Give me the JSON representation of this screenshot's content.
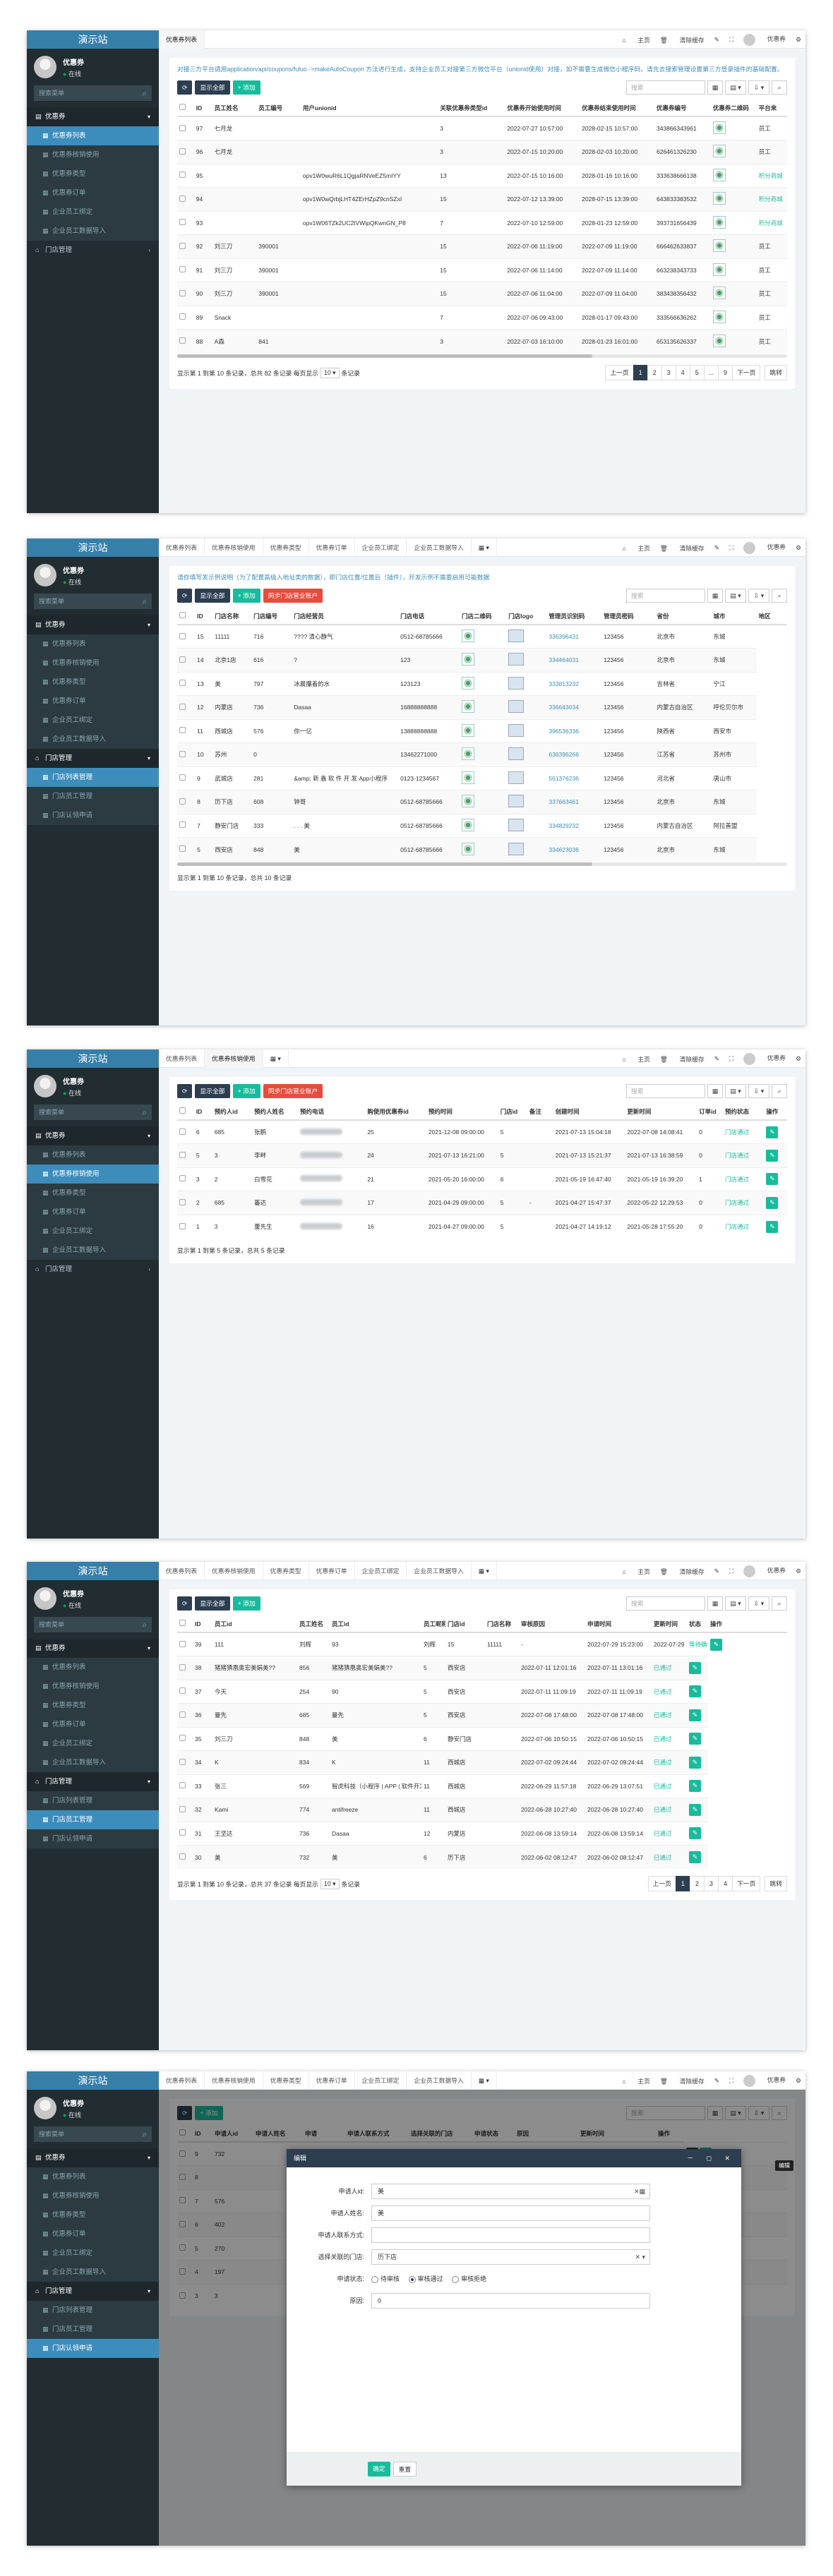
{
  "app": {
    "logo": "演示站",
    "user": "优惠券",
    "status": "在线",
    "search_placeholder": "搜索菜单"
  },
  "menu": {
    "group": "优惠券",
    "items": [
      "优惠券列表",
      "优惠券核销使用",
      "优惠券类型",
      "优惠券订单",
      "企业员工绑定",
      "企业员工数据导入"
    ],
    "store_group": "门店管理",
    "store_items": [
      "门店列表管理",
      "门店员工管理",
      "门店认领申请"
    ]
  },
  "topbar": {
    "home": "主页",
    "clear": "清除缓存",
    "admin": "优惠券"
  },
  "common": {
    "refresh": "⟳",
    "show_all": "显示全部",
    "add": "添加",
    "search_placeholder": "搜索",
    "edit": "编辑"
  },
  "shot1": {
    "tab": "优惠券列表",
    "tip": "对接三方平台调用application/api/coupons/fuluo ->makeAutoCoupon 方法进行生成，支持企业员工对接第三方微信平台（unionid使用）对接，如不需要生成微信小程序码，请先去搜索管理设置第三方登录插件的基础配置。",
    "headers": [
      "",
      "ID",
      "员工姓名",
      "员工编号",
      "用户unionid",
      "关联优惠券类型id",
      "优惠券开始使用时间",
      "优惠券结束使用时间",
      "优惠券编号",
      "优惠券二维码",
      "平台来"
    ],
    "rows": [
      [
        "97",
        "七月龙",
        "",
        "",
        "3",
        "2022-07-27 10:57:00",
        "2028-02-15 10:57:00",
        "343866343961",
        "",
        "员工"
      ],
      [
        "96",
        "七月龙",
        "",
        "",
        "3",
        "2022-07-15 10:20:00",
        "2028-02-03 10:20:00",
        "626461326230",
        "",
        "员工"
      ],
      [
        "95",
        "",
        "",
        "opv1W0wuR6L1QgjaRNVeEZ5mIYY",
        "13",
        "2022-07-15 10:16:00",
        "2028-01-16 10:16:00",
        "333638666138",
        "",
        "积分商城"
      ],
      [
        "94",
        "",
        "",
        "opv1W0wQrbjLHT4ZErHZpZ9cnSZxI",
        "15",
        "2022-07-12 13:39:00",
        "2028-07-15 13:39:00",
        "643833383532",
        "",
        "积分商城"
      ],
      [
        "93",
        "",
        "",
        "opv1W06TZk2UC2tVWipQKwnGN_P8",
        "7",
        "2022-07-10 12:59:00",
        "2028-01-23 12:59:00",
        "393731656439",
        "",
        "积分商城"
      ],
      [
        "92",
        "刘三刀",
        "390001",
        "",
        "15",
        "2022-07-06 11:19:00",
        "2022-07-09 11:19:00",
        "666462633837",
        "",
        "员工"
      ],
      [
        "91",
        "刘三刀",
        "390001",
        "",
        "15",
        "2022-07-06 11:14:00",
        "2022-07-09 11:14:00",
        "663238343733",
        "",
        "员工"
      ],
      [
        "90",
        "刘三刀",
        "390001",
        "",
        "15",
        "2022-07-06 11:04:00",
        "2022-07-09 11:04:00",
        "383438356432",
        "",
        "员工"
      ],
      [
        "89",
        "Snack",
        "",
        "",
        "7",
        "2022-07-06 09:43:00",
        "2028-01-17 09:43:00",
        "333566636262",
        "",
        "员工"
      ],
      [
        "88",
        "A森",
        "841",
        "",
        "3",
        "2022-07-03 16:10:00",
        "2028-01-23 16:01:00",
        "653135626337",
        "",
        "员工"
      ]
    ],
    "footer": {
      "summary": "显示第 1 到第 10 条记录，总共 82 条记录 每页显示",
      "per": "10 ▾",
      "suffix": "条记录"
    },
    "pages": [
      "上一页",
      "1",
      "2",
      "3",
      "4",
      "5",
      "...",
      "9",
      "下一页",
      "跳转"
    ]
  },
  "shot2": {
    "tabs": [
      "优惠券列表",
      "优惠券核销使用",
      "优惠券类型",
      "优惠券订单",
      "企业员工绑定",
      "企业员工数据导入"
    ],
    "tip": "请你填写发示例说明（为了配置高级入地址类的数据），即门店位置/位置后（插件），开发示例不需要启用可能数据",
    "sync": "同步门店营业账户",
    "headers": [
      "",
      "ID",
      "门店名称",
      "门店编号",
      "门店经营员",
      "门店电话",
      "门店二维码",
      "门店logo",
      "管理员识别码",
      "管理员密码",
      "省份",
      "城市",
      "地区"
    ],
    "rows": [
      [
        "15",
        "11111",
        "716",
        "???? 清心静气",
        "0512-68785666",
        "",
        "",
        "336396431",
        "123456",
        "北京市",
        "东城"
      ],
      [
        "14",
        "北京1店",
        "616",
        "?",
        "123",
        "",
        "",
        "334464031",
        "123456",
        "北京市",
        "东城"
      ],
      [
        "13",
        "美",
        "797",
        "冰晨攥着的水",
        "123123",
        "",
        "",
        "333813232",
        "123456",
        "吉林省",
        "宁江"
      ],
      [
        "12",
        "内蒙店",
        "736",
        "Dasaa",
        "16888888888",
        "",
        "",
        "336643034",
        "123456",
        "内蒙古自治区",
        "呼伦贝尔市"
      ],
      [
        "11",
        "西城店",
        "576",
        "你一亿",
        "13888888888",
        "",
        "",
        "396536336",
        "123456",
        "陕西省",
        "西安市"
      ],
      [
        "10",
        "苏州",
        "0",
        "",
        "13462271000",
        "",
        "",
        "636396266",
        "123456",
        "江苏省",
        "苏州市"
      ],
      [
        "9",
        "武城店",
        "281",
        "&amp; 新 鑫 软 件 开 发 App小程序",
        "0123-1234567",
        "",
        "",
        "561376236",
        "123456",
        "河北省",
        "唐山市"
      ],
      [
        "8",
        "历下店",
        "608",
        "钟哥",
        "0512-68785666",
        "",
        "",
        "337663461",
        "123456",
        "北京市",
        "东城"
      ],
      [
        "7",
        "静安门店",
        "333",
        ". . . 美",
        "0512-68785666",
        "",
        "",
        "334829232",
        "123456",
        "内蒙古自治区",
        "阿拉善盟"
      ],
      [
        "5",
        "西安店",
        "848",
        "美",
        "0512-68785666",
        "",
        "",
        "334623036",
        "123456",
        "北京市",
        "东城"
      ]
    ],
    "footer": "显示第 1 到第 10 条记录，总共 10 条记录"
  },
  "shot3": {
    "tabs": [
      "优惠券列表",
      "优惠券核销使用"
    ],
    "sync": "同步门店营业账户",
    "headers": [
      "",
      "ID",
      "预约人id",
      "预约人姓名",
      "预约电话",
      "购使用优惠券id",
      "预约时间",
      "门店id",
      "备注",
      "创建时间",
      "更新时间",
      "订单id",
      "预约状态",
      "操作"
    ],
    "rows": [
      [
        "6",
        "685",
        "张鹏",
        "",
        "25",
        "2021-12-08 09:00:00",
        "5",
        "",
        "2021-07-13 15:04:18",
        "2022-07-08 14:08:41",
        "0",
        "门店通过"
      ],
      [
        "5",
        "3",
        "李畔",
        "",
        "24",
        "2021-07-13 16:21:00",
        "5",
        "",
        "2021-07-13 15:21:37",
        "2021-07-13 16:38:59",
        "0",
        "门店通过"
      ],
      [
        "3",
        "2",
        "白雪花",
        "",
        "21",
        "2021-05-20 16:00:00",
        "6",
        "",
        "2021-05-19 16:47:40",
        "2021-05-19 16:39:20",
        "1",
        "门店通过"
      ],
      [
        "2",
        "685",
        "蕃达",
        "",
        "17",
        "2021-04-29 09:00:00",
        "5",
        "-",
        "2021-04-27 15:47:37",
        "2022-05-22 12:29:53",
        "0",
        "门店通过"
      ],
      [
        "1",
        "3",
        "董先生",
        "",
        "16",
        "2021-04-27 09:00:00",
        "5",
        "",
        "2021-04-27 14:19:12",
        "2021-05-28 17:55:20",
        "0",
        "门店通过"
      ]
    ],
    "footer": "显示第 1 到第 5 条记录，总共 5 条记录"
  },
  "shot4": {
    "tabs": [
      "优惠券列表",
      "优惠券核销使用",
      "优惠券类型",
      "优惠券订单",
      "企业员工绑定",
      "企业员工数据导入"
    ],
    "headers": [
      "",
      "ID",
      "员工id",
      "员工姓名",
      "员工id",
      "员工昵称",
      "门店id",
      "门店名称",
      "审核原因",
      "申请时间",
      "更新时间",
      "状态",
      "操作"
    ],
    "rows": [
      [
        "39",
        "111",
        "刘辉",
        "93",
        "刘辉",
        "15",
        "11111",
        "-",
        "2022-07-29 15:23:00",
        "2022-07-29 15:23:00",
        "等待确认"
      ],
      [
        "38",
        "猪猪猜凰奥宏美娟美??",
        "856",
        "猪猪猜凰奥宏美娟美??",
        "5",
        "西安店",
        "",
        "2022-07-11 12:01:16",
        "2022-07-11 13:01:16",
        "已通过"
      ],
      [
        "37",
        "今天",
        "254",
        "90",
        "5",
        "西安店",
        "",
        "2022-07-11 11:09:19",
        "2022-07-11 11:09:19",
        "已通过"
      ],
      [
        "36",
        "曼先",
        "685",
        "曼先",
        "5",
        "西安店",
        "",
        "2022-07-08 17:48:00",
        "2022-07-08 17:48:00",
        "已通过"
      ],
      [
        "35",
        "刘三刀",
        "848",
        "美",
        "6",
        "静安门店",
        "",
        "2022-07-06 10:50:15",
        "2022-07-06 10:50:15",
        "已通过"
      ],
      [
        "34",
        "K",
        "834",
        "K",
        "11",
        "西城店",
        "",
        "2022-07-02 09:24:44",
        "2022-07-02 09:24:44",
        "已通过"
      ],
      [
        "33",
        "张三",
        "569",
        "智虎科技（小程序 | APP | 软件开发",
        "11",
        "西城店",
        "",
        "2022-06-29 11:57:18",
        "2022-06-29 13:07:51",
        "已通过"
      ],
      [
        "32",
        "Kami",
        "774",
        "antifreeze",
        "11",
        "西城店",
        "",
        "2022-06-28 10:27:40",
        "2022-06-28 10:27:40",
        "已通过"
      ],
      [
        "31",
        "王坚达",
        "736",
        "Dasaa",
        "12",
        "内蒙店",
        "",
        "2022-06-08 13:59:14",
        "2022-06-08 13:59:14",
        "已通过"
      ],
      [
        "30",
        "美",
        "732",
        "美",
        "6",
        "历下店",
        "",
        "2022-06-02 08:12:47",
        "2022-06-02 08:12:47",
        "已通过"
      ]
    ],
    "footer": {
      "summary": "显示第 1 到第 10 条记录，总共 37 条记录 每页显示",
      "per": "10 ▾",
      "suffix": "条记录"
    },
    "pages": [
      "上一页",
      "1",
      "2",
      "3",
      "4",
      "下一页",
      "跳转"
    ]
  },
  "shot5": {
    "tabs": [
      "优惠券列表",
      "优惠券核销使用",
      "优惠券类型",
      "优惠券订单",
      "企业员工绑定",
      "企业员工数据导入"
    ],
    "headers": [
      "",
      "ID",
      "申请人id",
      "申请人姓名",
      "申请",
      "申请人联系方式",
      "选择关联的门店",
      "申请状态",
      "原因",
      "更新时间",
      "操作"
    ],
    "rows": [
      [
        "9",
        "732",
        "",
        "",
        "",
        "",
        "",
        "",
        "",
        "2022-07-29 09:13:40"
      ],
      [
        "8",
        "",
        "",
        "",
        "",
        "",
        "",
        "",
        "",
        "2022-07-29 10:22:28"
      ],
      [
        "7",
        "576",
        "",
        "",
        "",
        "",
        "",
        "",
        "",
        "2022-07-29 16:19:38"
      ],
      [
        "6",
        "402",
        "",
        "",
        "",
        "",
        "",
        "",
        "",
        "2022-07-29 14:16:48"
      ],
      [
        "5",
        "270",
        "",
        "",
        "",
        "",
        "",
        "",
        "",
        "2022-07-29 14:17:28"
      ],
      [
        "4",
        "197",
        "",
        "",
        "",
        "",
        "",
        "",
        "",
        "2022-07-29 16:03:37"
      ],
      [
        "3",
        "3",
        "",
        "",
        "",
        "",
        "",
        "",
        "",
        "2022-07-29 17:58:06"
      ]
    ],
    "modal": {
      "title": "编辑",
      "controls": "－ ◻ ✕",
      "applicant_id_label": "申请人id:",
      "applicant_id": "美",
      "applicant_name_label": "申请人姓名:",
      "applicant_name": "美",
      "contact_label": "申请人联系方式:",
      "contact": "",
      "store_label": "选择关联的门店:",
      "store": "历下店",
      "status_label": "申请状态:",
      "status_options": [
        "待审核",
        "审核通过",
        "审核拒绝"
      ],
      "reason_label": "原因:",
      "reason": "0",
      "ok": "确定",
      "reset": "重置"
    },
    "tooltip": "编辑"
  }
}
